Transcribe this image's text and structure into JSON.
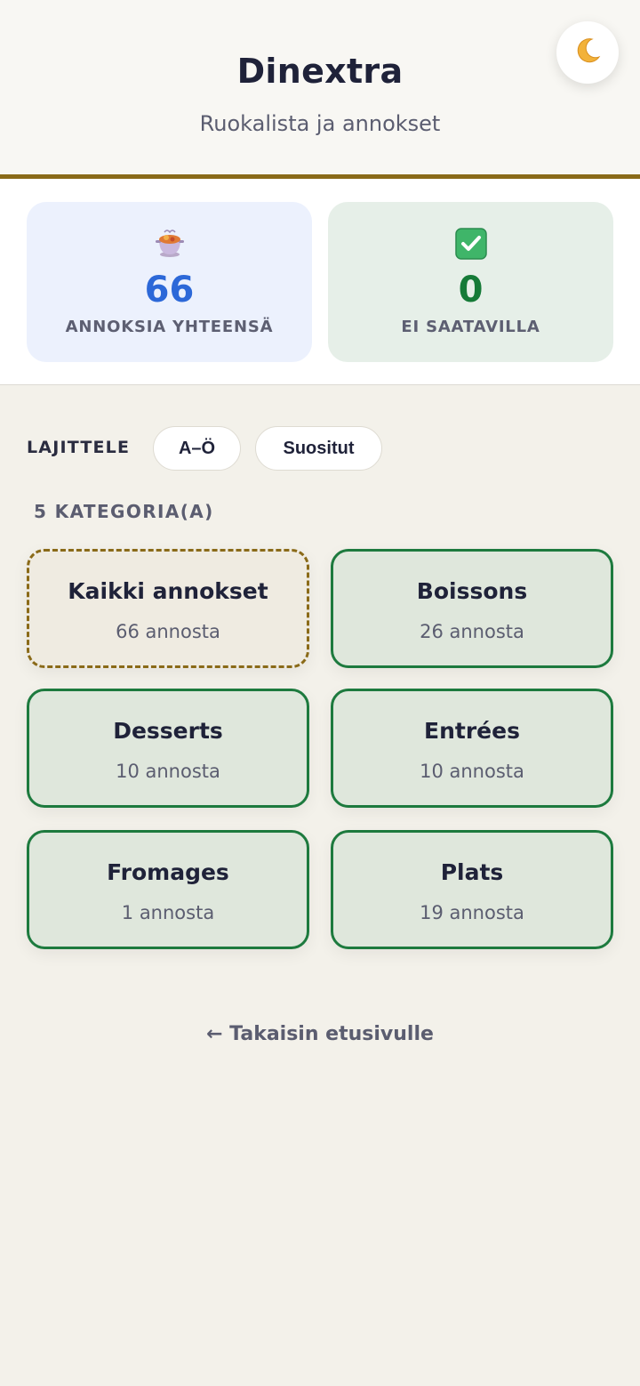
{
  "header": {
    "title": "Dinextra",
    "subtitle": "Ruokalista ja annokset",
    "theme_toggle_icon": "crescent-moon-icon",
    "accent_color": "#8a6a18"
  },
  "stats": {
    "total": {
      "icon": "cooking-pot-icon",
      "value": "66",
      "label": "ANNOKSIA YHTEENSÄ",
      "color": "#2c68d8"
    },
    "unavailable": {
      "icon": "checkmark-box-icon",
      "value": "0",
      "label": "EI SAATAVILLA",
      "color": "#157a37"
    }
  },
  "sort": {
    "label": "LAJITTELE",
    "options": [
      "A–Ö",
      "Suositut"
    ]
  },
  "categories": {
    "count_label": "5 KATEGORIA(A)",
    "items": [
      {
        "name": "Kaikki annokset",
        "count": "66 annosta"
      },
      {
        "name": "Boissons",
        "count": "26 annosta"
      },
      {
        "name": "Desserts",
        "count": "10 annosta"
      },
      {
        "name": "Entrées",
        "count": "10 annosta"
      },
      {
        "name": "Fromages",
        "count": "1 annosta"
      },
      {
        "name": "Plats",
        "count": "19 annosta"
      }
    ]
  },
  "footer": {
    "back_link": "← Takaisin etusivulle"
  }
}
